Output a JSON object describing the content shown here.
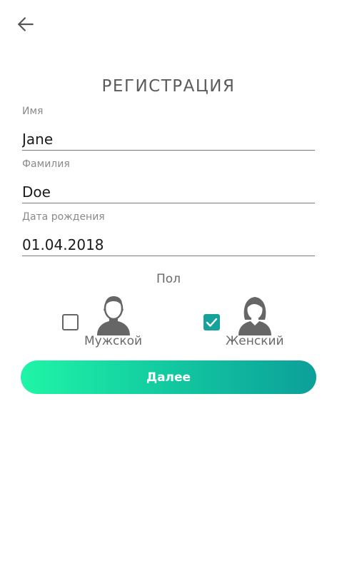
{
  "header": {
    "back_icon": "arrow-left-icon"
  },
  "title": "РЕГИСТРАЦИЯ",
  "form": {
    "first_name": {
      "label": "Имя",
      "value": "Jane"
    },
    "last_name": {
      "label": "Фамилия",
      "value": "Doe"
    },
    "birth_date": {
      "label": "Дата рождения",
      "value": "01.04.2018"
    }
  },
  "gender": {
    "label": "Пол",
    "options": [
      {
        "label": "Мужской",
        "checked": false,
        "icon": "male-avatar-icon"
      },
      {
        "label": "Женский",
        "checked": true,
        "icon": "female-avatar-icon"
      }
    ]
  },
  "actions": {
    "next_label": "Далее"
  },
  "colors": {
    "accent": "#16a29b",
    "gradient_start": "#1ff5a7",
    "gradient_end": "#0c9f9a"
  }
}
